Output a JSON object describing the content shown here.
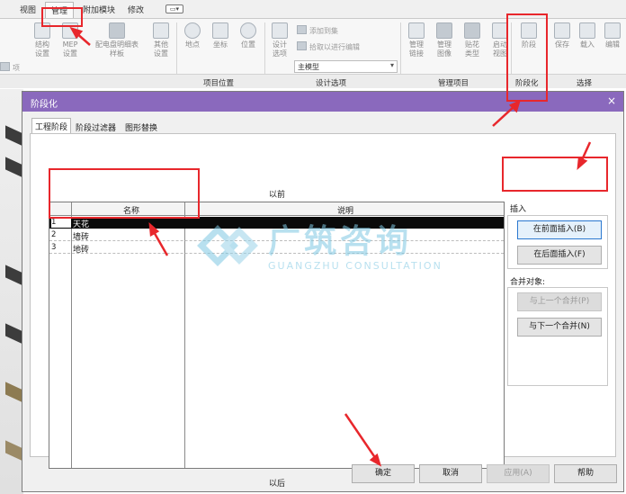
{
  "ribbon": {
    "tabs": [
      "视图",
      "管理",
      "附加模块",
      "修改"
    ],
    "active_tab": "管理",
    "buttons": [
      {
        "label": "结构\n设置"
      },
      {
        "label": "MEP\n设置"
      },
      {
        "label": "配电盘明细表\n样板"
      },
      {
        "label": "其他\n设置"
      },
      {
        "label": "地点"
      },
      {
        "label": "坐标"
      },
      {
        "label": "位置"
      },
      {
        "label": "设计\n选项"
      },
      {
        "label": "管理\n链接"
      },
      {
        "label": "管理\n图像"
      },
      {
        "label": "贴花\n类型"
      },
      {
        "label": "启动\n视图"
      },
      {
        "label": "阶段"
      },
      {
        "label": "保存"
      },
      {
        "label": "载入"
      },
      {
        "label": "编辑"
      }
    ],
    "small_commands": [
      "添加到集",
      "拾取以进行编辑"
    ],
    "design_option_value": "主模型",
    "groups": [
      "项目位置",
      "设计选项",
      "管理项目",
      "阶段化",
      "选择"
    ],
    "partial_left": "项"
  },
  "dialog": {
    "title": "阶段化",
    "close_glyph": "×",
    "tabs": [
      "工程阶段",
      "阶段过滤器",
      "图形替换"
    ],
    "active_tab": "工程阶段",
    "label_before": "以前",
    "label_after": "以后",
    "table": {
      "columns": [
        "名称",
        "说明"
      ],
      "rows": [
        {
          "num": "1",
          "name": "天花",
          "desc": ""
        },
        {
          "num": "2",
          "name": "墙砖",
          "desc": ""
        },
        {
          "num": "3",
          "name": "地砖",
          "desc": ""
        }
      ],
      "selected_row": 0
    },
    "insert_label": "插入",
    "insert_before": "在前面插入(B)",
    "insert_after": "在后面插入(F)",
    "merge_label": "合并对象:",
    "merge_prev": "与上一个合并(P)",
    "merge_next": "与下一个合并(N)",
    "ok": "确定",
    "cancel": "取消",
    "apply": "应用(A)",
    "help": "帮助"
  },
  "watermark": {
    "brand": "广筑咨询",
    "subtitle": "GUANGZHU CONSULTATION"
  },
  "colors": {
    "title_bar": "#8a69bd",
    "annotation_red": "#e8272c",
    "watermark": "#7fc8e3"
  }
}
